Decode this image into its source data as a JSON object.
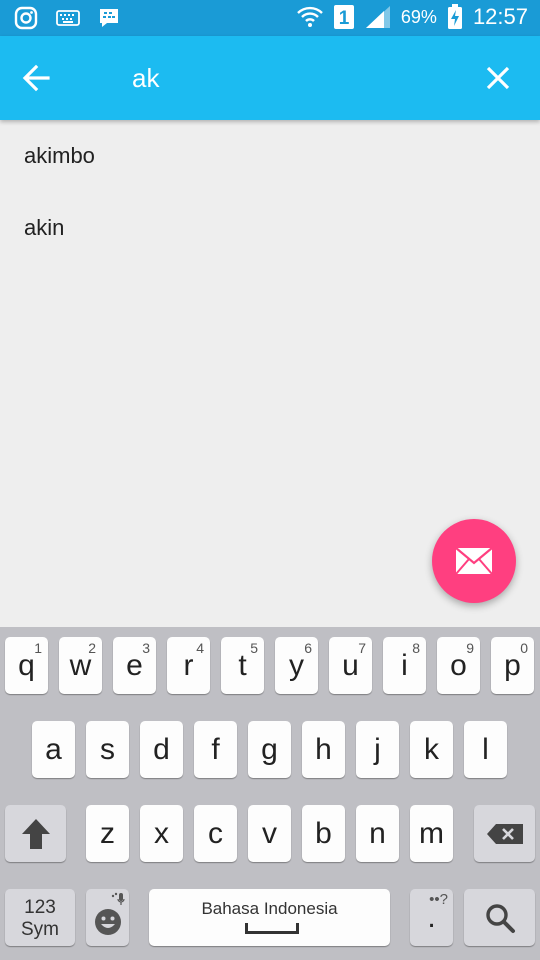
{
  "status_bar": {
    "left_icons": [
      "instagram-icon",
      "keyboard-icon",
      "bbm-icon"
    ],
    "sim_badge": "1",
    "battery_percent": "69%",
    "time": "12:57",
    "colors": {
      "background": "#1a9bd6"
    }
  },
  "search": {
    "query": "ak",
    "back_icon": "arrow-left-icon",
    "clear_icon": "close-icon",
    "colors": {
      "appbar": "#1cbbf1"
    }
  },
  "suggestions": [
    {
      "text": "akimbo"
    },
    {
      "text": "akin"
    }
  ],
  "fab": {
    "icon": "mail-icon",
    "color": "#ff3f80"
  },
  "keyboard": {
    "row1": [
      {
        "k": "q",
        "h": "1"
      },
      {
        "k": "w",
        "h": "2"
      },
      {
        "k": "e",
        "h": "3"
      },
      {
        "k": "r",
        "h": "4"
      },
      {
        "k": "t",
        "h": "5"
      },
      {
        "k": "y",
        "h": "6"
      },
      {
        "k": "u",
        "h": "7"
      },
      {
        "k": "i",
        "h": "8"
      },
      {
        "k": "o",
        "h": "9"
      },
      {
        "k": "p",
        "h": "0"
      }
    ],
    "row2": [
      "a",
      "s",
      "d",
      "f",
      "g",
      "h",
      "j",
      "k",
      "l"
    ],
    "row3": [
      "z",
      "x",
      "c",
      "v",
      "b",
      "n",
      "m"
    ],
    "sym_label_1": "123",
    "sym_label_2": "Sym",
    "space_label": "Bahasa Indonesia",
    "period_key": ".",
    "period_hint": "••?",
    "icons": [
      "shift-icon",
      "backspace-icon",
      "emoji-icon",
      "mic-icon",
      "search-icon"
    ]
  }
}
